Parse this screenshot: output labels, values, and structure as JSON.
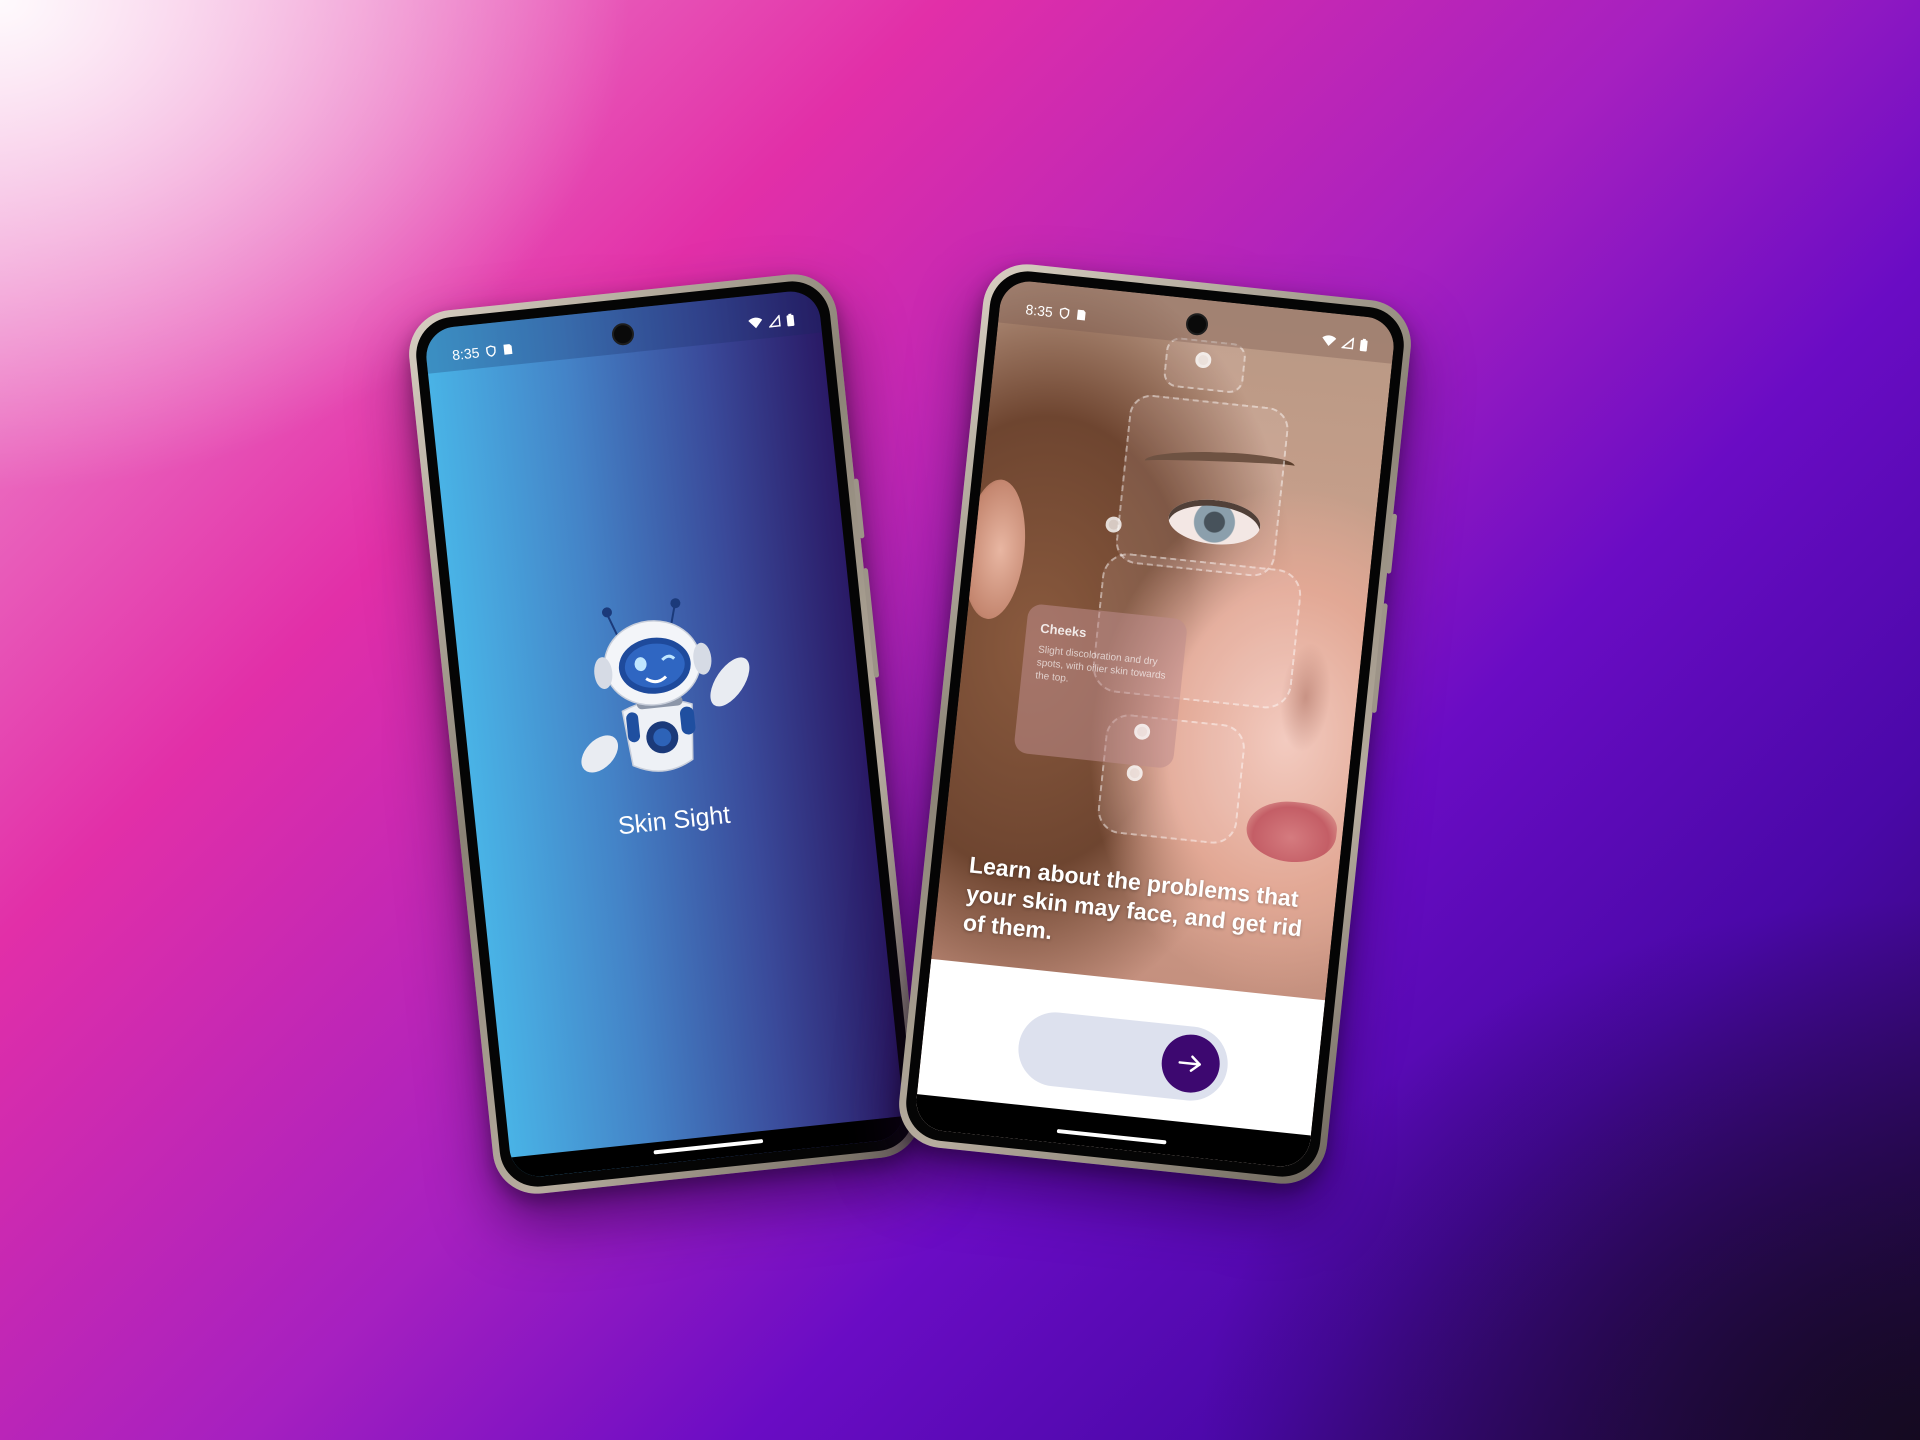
{
  "left_phone": {
    "status_time": "8:35",
    "app_name": "Skin Sight",
    "colors": {
      "gradient_start": "#49b3e6",
      "gradient_end": "#2a1a66"
    }
  },
  "right_phone": {
    "status_time": "8:35",
    "info_card": {
      "title": "Cheeks",
      "description": "Slight discoloration and dry spots, with oilier skin towards the top."
    },
    "headline": "Learn about the problems that your skin may face, and get rid of them.",
    "next_icon": "arrow-right-icon",
    "colors": {
      "button": "#3d0870",
      "slider_track": "#dde1ee"
    }
  }
}
